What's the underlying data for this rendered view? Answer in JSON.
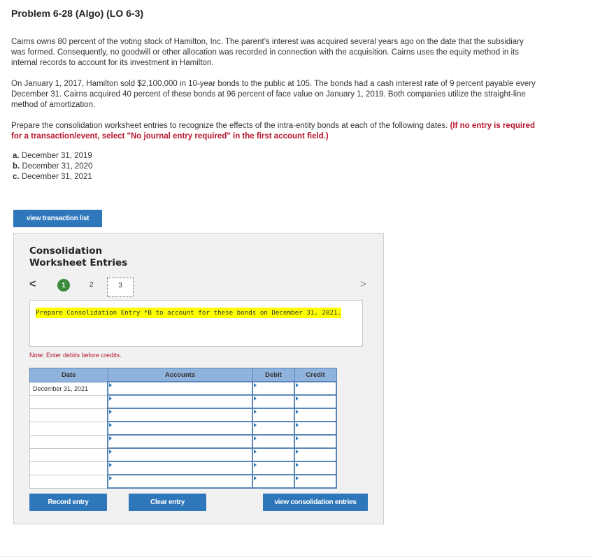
{
  "problem": {
    "title": "Problem 6-28 (Algo) (LO 6-3)",
    "para1": "Cairns owns 80 percent of the voting stock of Hamilton, Inc. The parent’s interest was acquired several years ago on the date that the subsidiary was formed. Consequently, no goodwill or other allocation was recorded in connection with the acquisition. Cairns uses the equity method in its internal records to account for its investment in Hamilton.",
    "para2": "On January 1, 2017, Hamilton sold $2,100,000 in 10-year bonds to the public at 105. The bonds had a cash interest rate of 9 percent payable every December 31. Cairns acquired 40 percent of these bonds at 96 percent of face value on January 1, 2019. Both companies utilize the straight-line method of amortization.",
    "para3_text": "Prepare the consolidation worksheet entries to recognize the effects of the intra-entity bonds at each of the following dates.",
    "para3_required": "(If no entry is required for a transaction/event, select \"No journal entry required\" in the first account field.)",
    "parts": [
      {
        "letter": "a.",
        "text": "December 31, 2019"
      },
      {
        "letter": "b.",
        "text": "December 31, 2020"
      },
      {
        "letter": "c.",
        "text": "December 31, 2021"
      }
    ]
  },
  "buttons": {
    "view_transaction_list": "view transaction list",
    "record_entry": "Record entry",
    "clear_entry": "Clear entry",
    "view_consolidation_entries": "view consolidation entries"
  },
  "worksheet": {
    "title_line1": "Consolidation",
    "title_line2": "Worksheet Entries",
    "nav_prev": "<",
    "nav_next": ">",
    "steps": [
      "1",
      "2",
      "3"
    ],
    "current_step": "3",
    "instruction": "Prepare Consolidation Entry *B to account for these bonds on December 31, 2021.",
    "note": "Note: Enter debits before credits.",
    "table": {
      "headers": {
        "date": "Date",
        "accounts": "Accounts",
        "debit": "Debit",
        "credit": "Credit"
      },
      "rows": [
        {
          "date": "December 31, 2021"
        },
        {
          "date": ""
        },
        {
          "date": ""
        },
        {
          "date": ""
        },
        {
          "date": ""
        },
        {
          "date": ""
        },
        {
          "date": ""
        },
        {
          "date": ""
        }
      ]
    }
  },
  "colors": {
    "accent": "#2f77bb",
    "required_text": "#b8172e",
    "highlight": "#ffff00",
    "step_complete": "#3c8a3c",
    "table_header": "#8fb3dc"
  }
}
